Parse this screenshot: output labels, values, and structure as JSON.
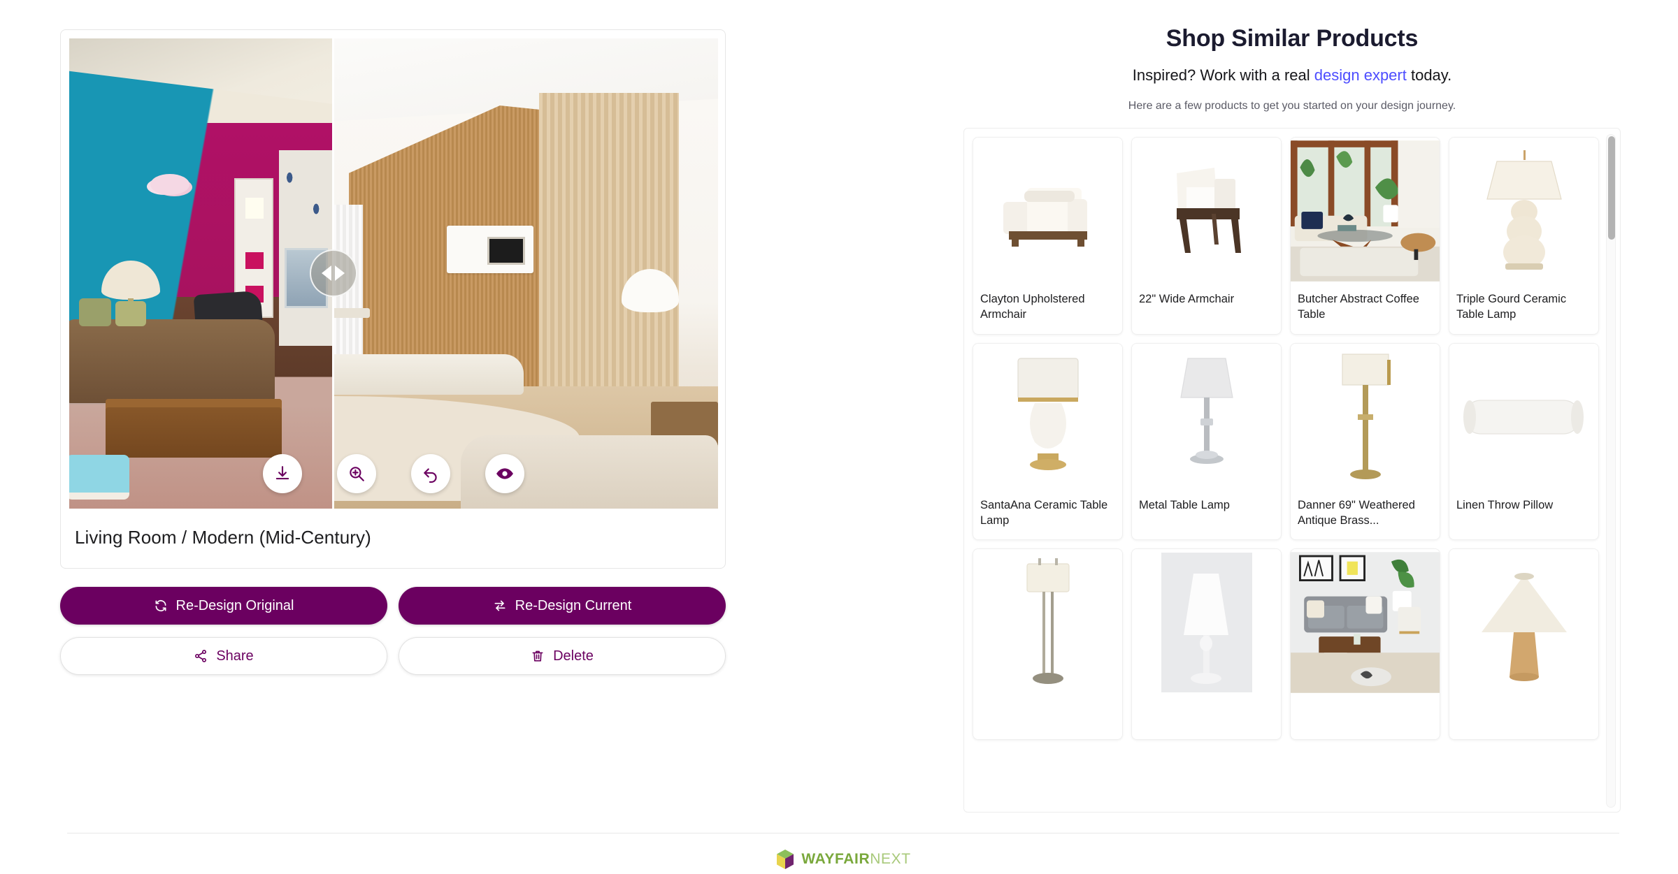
{
  "design": {
    "title": "Living Room / Modern (Mid-Century)",
    "tools": [
      {
        "name": "download-icon",
        "label": "Download"
      },
      {
        "name": "zoom-in-icon",
        "label": "Zoom In"
      },
      {
        "name": "undo-icon",
        "label": "Undo"
      },
      {
        "name": "eye-icon",
        "label": "View"
      }
    ],
    "slider": {
      "position_percent": 40
    }
  },
  "actions": {
    "redesign_original": "Re-Design Original",
    "redesign_current": "Re-Design Current",
    "share": "Share",
    "delete": "Delete"
  },
  "shop": {
    "title": "Shop Similar Products",
    "subtitle_before": "Inspired? Work with a real ",
    "subtitle_link": "design expert",
    "subtitle_after": " today.",
    "note": "Here are a few products to get you started on your design journey.",
    "link_color": "#4d4dff"
  },
  "products": [
    {
      "name": "Clayton Upholstered Armchair",
      "art": "armchair"
    },
    {
      "name": "22\" Wide Armchair",
      "art": "wide-armchair"
    },
    {
      "name": "Butcher Abstract Coffee Table",
      "art": "room-scene-coffee"
    },
    {
      "name": "Triple Gourd Ceramic Table Lamp",
      "art": "gourd-lamp"
    },
    {
      "name": "SantaAna Ceramic Table Lamp",
      "art": "ceramic-lamp"
    },
    {
      "name": "Metal Table Lamp",
      "art": "metal-lamp"
    },
    {
      "name": "Danner 69\" Weathered Antique Brass...",
      "art": "brass-floor-lamp"
    },
    {
      "name": "Linen Throw Pillow",
      "art": "bolster-pillow"
    },
    {
      "name": "",
      "art": "tall-floor-lamp"
    },
    {
      "name": "",
      "art": "white-floor-lamp"
    },
    {
      "name": "",
      "art": "room-scene-sofa"
    },
    {
      "name": "",
      "art": "cone-lamp"
    }
  ],
  "footer": {
    "logo_primary": "WAYFAIR",
    "logo_secondary": "NEXT",
    "logo_icon": "cube-logo-icon"
  },
  "colors": {
    "brand_purple": "#6B0060",
    "link_blue": "#4d4dff",
    "logo_green": "#7aa83c",
    "logo_green_light": "#a8c97a"
  }
}
